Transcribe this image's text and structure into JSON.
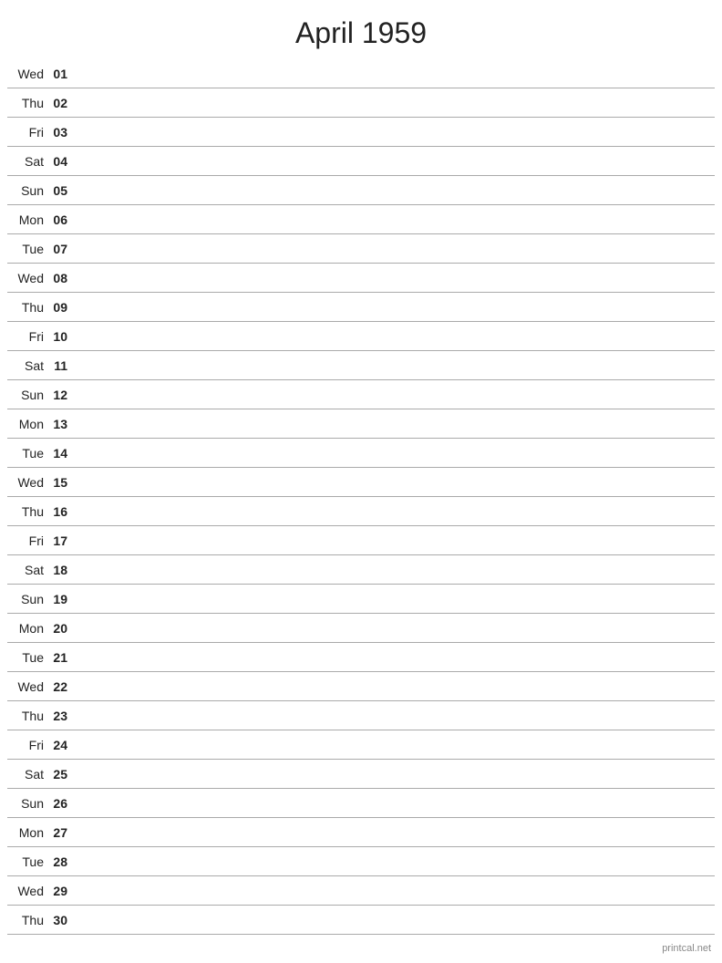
{
  "title": "April 1959",
  "footer": "printcal.net",
  "days": [
    {
      "name": "Wed",
      "num": "01"
    },
    {
      "name": "Thu",
      "num": "02"
    },
    {
      "name": "Fri",
      "num": "03"
    },
    {
      "name": "Sat",
      "num": "04"
    },
    {
      "name": "Sun",
      "num": "05"
    },
    {
      "name": "Mon",
      "num": "06"
    },
    {
      "name": "Tue",
      "num": "07"
    },
    {
      "name": "Wed",
      "num": "08"
    },
    {
      "name": "Thu",
      "num": "09"
    },
    {
      "name": "Fri",
      "num": "10"
    },
    {
      "name": "Sat",
      "num": "11"
    },
    {
      "name": "Sun",
      "num": "12"
    },
    {
      "name": "Mon",
      "num": "13"
    },
    {
      "name": "Tue",
      "num": "14"
    },
    {
      "name": "Wed",
      "num": "15"
    },
    {
      "name": "Thu",
      "num": "16"
    },
    {
      "name": "Fri",
      "num": "17"
    },
    {
      "name": "Sat",
      "num": "18"
    },
    {
      "name": "Sun",
      "num": "19"
    },
    {
      "name": "Mon",
      "num": "20"
    },
    {
      "name": "Tue",
      "num": "21"
    },
    {
      "name": "Wed",
      "num": "22"
    },
    {
      "name": "Thu",
      "num": "23"
    },
    {
      "name": "Fri",
      "num": "24"
    },
    {
      "name": "Sat",
      "num": "25"
    },
    {
      "name": "Sun",
      "num": "26"
    },
    {
      "name": "Mon",
      "num": "27"
    },
    {
      "name": "Tue",
      "num": "28"
    },
    {
      "name": "Wed",
      "num": "29"
    },
    {
      "name": "Thu",
      "num": "30"
    }
  ]
}
